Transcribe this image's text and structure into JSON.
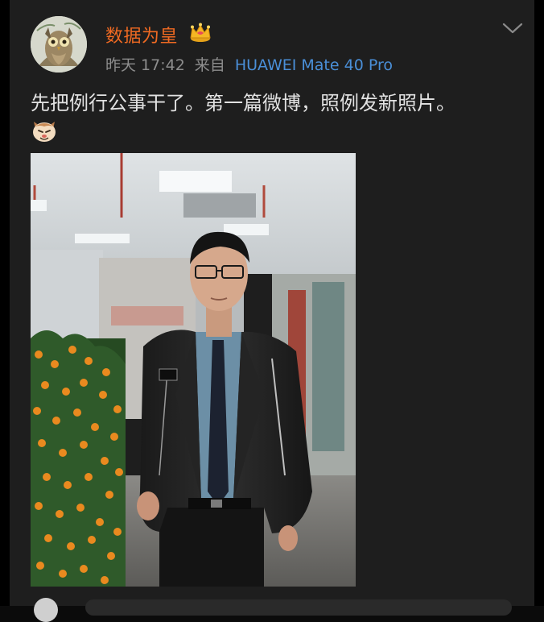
{
  "post": {
    "author": "数据为皇",
    "time": "昨天 17:42",
    "source": "来自",
    "device": "HUAWEI Mate 40 Pro",
    "text": "先把例行公事干了。第一篇微博，照例发新照片。"
  },
  "icons": {
    "crown": "crown-icon",
    "menu": "chevron-down-icon",
    "emoji": "cat-face-emoji"
  },
  "colors": {
    "username": "#f06a22",
    "device_link": "#4a8fd8",
    "meta_gray": "#8d8d8d",
    "card_bg": "#1e1e1e",
    "text": "#e2e2e2"
  }
}
